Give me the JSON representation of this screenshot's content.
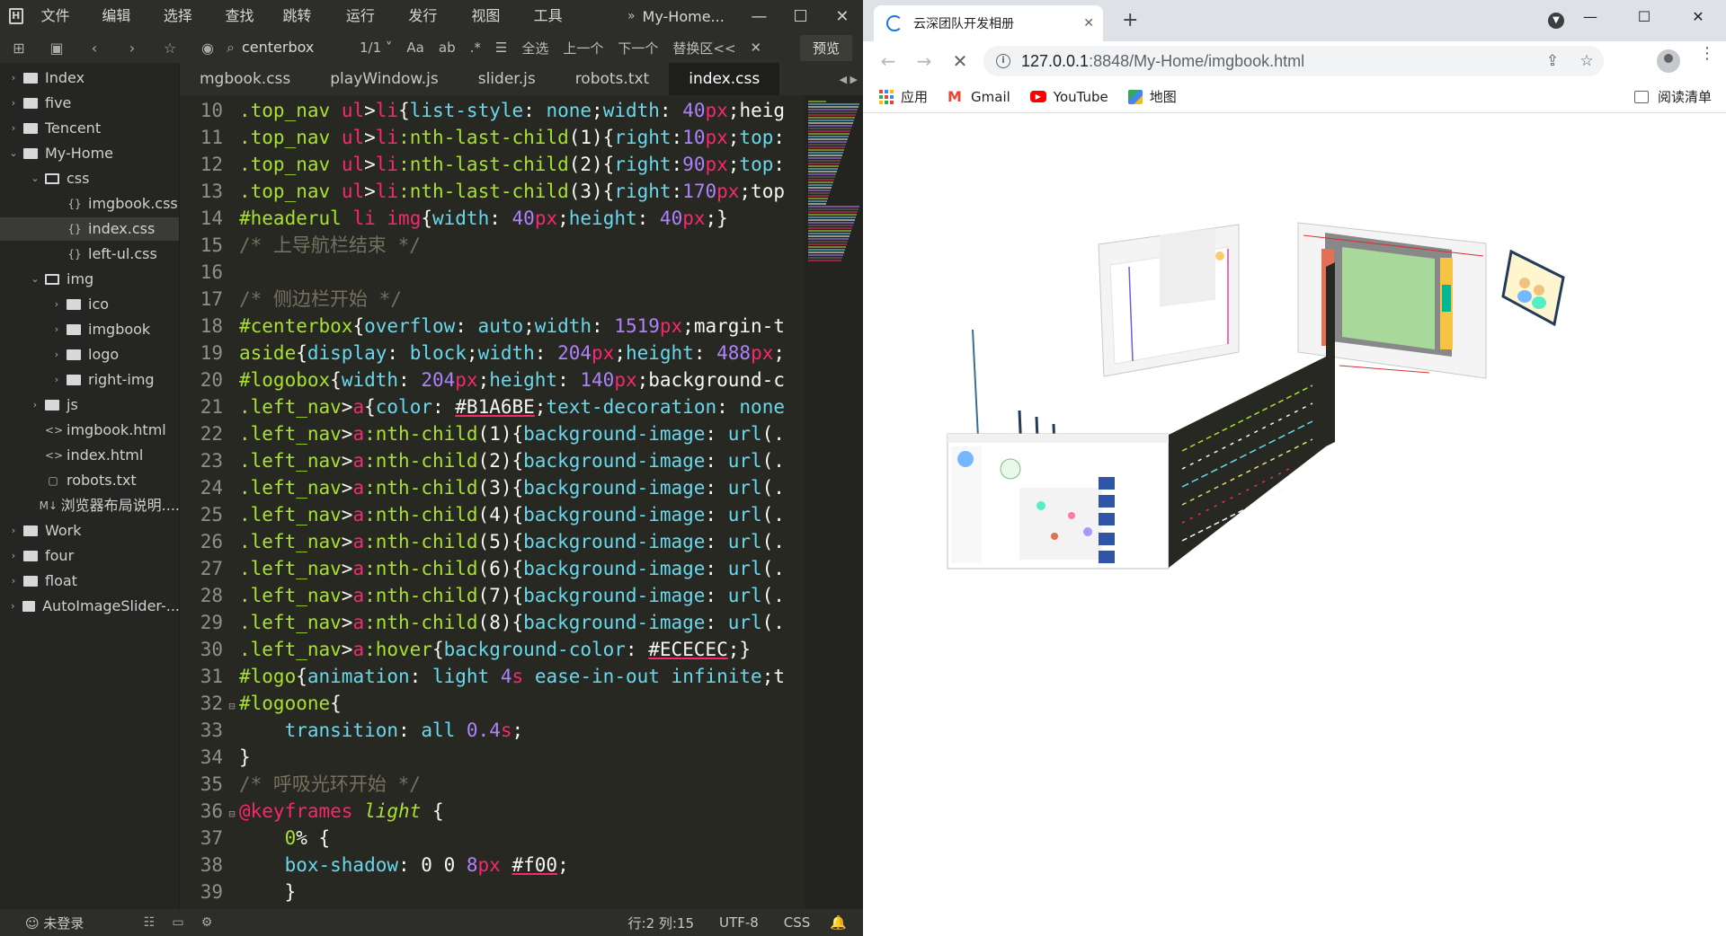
{
  "editor": {
    "menu": [
      "文件(F)",
      "编辑(E)",
      "选择(S)",
      "查找(I)",
      "跳转(G)",
      "运行(R)",
      "发行(U)",
      "视图(V)",
      "工具(T)"
    ],
    "title": "My-Home...",
    "toolbar": {
      "search_text": "centerbox",
      "count": "1/1",
      "labels": [
        "全选",
        "上一个",
        "下一个",
        "替换区<<"
      ],
      "preview": "预览"
    },
    "tree": [
      {
        "label": "Index",
        "type": "folder",
        "depth": 0,
        "expanded": false
      },
      {
        "label": "five",
        "type": "folder",
        "depth": 0,
        "expanded": false
      },
      {
        "label": "Tencent",
        "type": "folder",
        "depth": 0,
        "expanded": false
      },
      {
        "label": "My-Home",
        "type": "folder",
        "depth": 0,
        "expanded": true
      },
      {
        "label": "css",
        "type": "folder",
        "depth": 1,
        "expanded": true
      },
      {
        "label": "imgbook.css",
        "type": "css",
        "depth": 2
      },
      {
        "label": "index.css",
        "type": "css",
        "depth": 2,
        "selected": true
      },
      {
        "label": "left-ul.css",
        "type": "css",
        "depth": 2
      },
      {
        "label": "img",
        "type": "folder",
        "depth": 1,
        "expanded": true
      },
      {
        "label": "ico",
        "type": "folder",
        "depth": 2,
        "expanded": false
      },
      {
        "label": "imgbook",
        "type": "folder",
        "depth": 2,
        "expanded": false
      },
      {
        "label": "logo",
        "type": "folder",
        "depth": 2,
        "expanded": false
      },
      {
        "label": "right-img",
        "type": "folder",
        "depth": 2,
        "expanded": false
      },
      {
        "label": "js",
        "type": "folder",
        "depth": 1,
        "expanded": false
      },
      {
        "label": "imgbook.html",
        "type": "html",
        "depth": 1
      },
      {
        "label": "index.html",
        "type": "html",
        "depth": 1
      },
      {
        "label": "robots.txt",
        "type": "txt",
        "depth": 1
      },
      {
        "label": "浏览器布局说明....",
        "type": "md",
        "depth": 1
      },
      {
        "label": "Work",
        "type": "folder",
        "depth": 0,
        "expanded": false
      },
      {
        "label": "four",
        "type": "folder",
        "depth": 0,
        "expanded": false
      },
      {
        "label": "float",
        "type": "folder",
        "depth": 0,
        "expanded": false
      },
      {
        "label": "AutoImageSlider-...",
        "type": "folder",
        "depth": 0,
        "expanded": false
      }
    ],
    "tabs": [
      "mgbook.css",
      "playWindow.js",
      "slider.js",
      "robots.txt",
      "index.css"
    ],
    "active_tab": "index.css",
    "code": [
      {
        "n": "10",
        "t": ".top_nav ul>li{list-style: none;width: 40px;heig"
      },
      {
        "n": "11",
        "t": ".top_nav ul>li:nth-last-child(1){right:10px;top:"
      },
      {
        "n": "12",
        "t": ".top_nav ul>li:nth-last-child(2){right:90px;top:"
      },
      {
        "n": "13",
        "t": ".top_nav ul>li:nth-last-child(3){right:170px;top"
      },
      {
        "n": "14",
        "t": "#headerul li img{width: 40px;height: 40px;}"
      },
      {
        "n": "15",
        "t": "/* 上导航栏结束 */"
      },
      {
        "n": "16",
        "t": ""
      },
      {
        "n": "17",
        "t": "/* 侧边栏开始 */"
      },
      {
        "n": "18",
        "t": "#centerbox{overflow: auto;width: 1519px;margin-t"
      },
      {
        "n": "19",
        "t": "aside{display: block;width: 204px;height: 488px;"
      },
      {
        "n": "20",
        "t": "#logobox{width: 204px;height: 140px;background-c"
      },
      {
        "n": "21",
        "t": ".left_nav>a{color: #B1A6BE;text-decoration: none"
      },
      {
        "n": "22",
        "t": ".left_nav>a:nth-child(1){background-image: url(."
      },
      {
        "n": "23",
        "t": ".left_nav>a:nth-child(2){background-image: url(."
      },
      {
        "n": "24",
        "t": ".left_nav>a:nth-child(3){background-image: url(."
      },
      {
        "n": "25",
        "t": ".left_nav>a:nth-child(4){background-image: url(."
      },
      {
        "n": "26",
        "t": ".left_nav>a:nth-child(5){background-image: url(."
      },
      {
        "n": "27",
        "t": ".left_nav>a:nth-child(6){background-image: url(."
      },
      {
        "n": "28",
        "t": ".left_nav>a:nth-child(7){background-image: url(."
      },
      {
        "n": "29",
        "t": ".left_nav>a:nth-child(8){background-image: url(."
      },
      {
        "n": "30",
        "t": ".left_nav>a:hover{background-color: #ECECEC;}"
      },
      {
        "n": "31",
        "t": "#logo{animation: light 4s ease-in-out infinite;t"
      },
      {
        "n": "32",
        "t": "#logoone{",
        "fold": true
      },
      {
        "n": "33",
        "t": "    transition: all 0.4s;"
      },
      {
        "n": "34",
        "t": "}"
      },
      {
        "n": "35",
        "t": "/* 呼吸光环开始 */"
      },
      {
        "n": "36",
        "t": "@keyframes light {",
        "fold": true
      },
      {
        "n": "37",
        "t": "    0% {"
      },
      {
        "n": "38",
        "t": "    box-shadow: 0 0 8px #f00;"
      },
      {
        "n": "39",
        "t": "    }"
      }
    ],
    "status": {
      "login": "未登录",
      "position": "行:2  列:15",
      "encoding": "UTF-8",
      "language": "CSS"
    }
  },
  "browser": {
    "tab_title": "云深团队开发相册",
    "url_host": "127.0.0.1",
    "url_rest": ":8848/My-Home/imgbook.html",
    "bookmarks": [
      "应用",
      "Gmail",
      "YouTube",
      "地图"
    ],
    "reading_list": "阅读清单",
    "colors": {
      "accent": "#1a73e8",
      "youtube": "#ff0000",
      "gmail": "#ea4335"
    }
  }
}
